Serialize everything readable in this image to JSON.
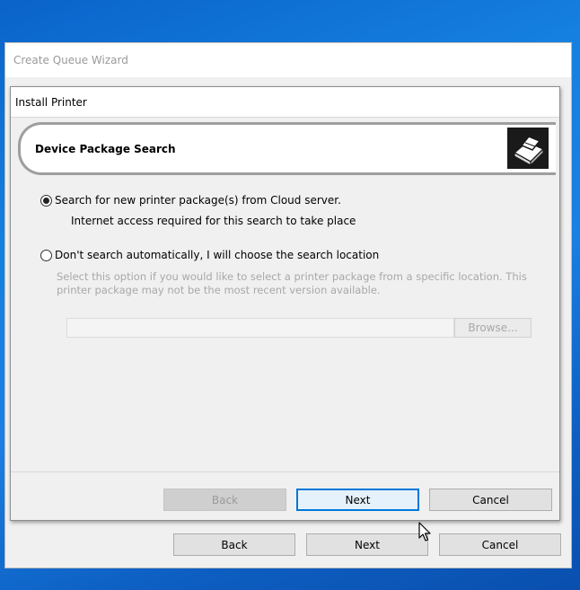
{
  "outer_window": {
    "title": "Create Queue Wizard",
    "back_label": "Back",
    "next_label": "Next",
    "cancel_label": "Cancel"
  },
  "inner_window": {
    "title": "Install Printer",
    "header_title": "Device Package Search",
    "header_icon": "printer-icon",
    "option_cloud": {
      "label": "Search for new printer package(s) from Cloud server.",
      "note": "Internet access required for this search to take place",
      "selected": true
    },
    "option_manual": {
      "label": "Don't search automatically, I will choose the search location",
      "note_line1": "Select this option if you would like to select a printer package from a specific location. This",
      "note_line2": "printer package may not be the most recent version available.",
      "selected": false
    },
    "path_input_value": "",
    "browse_label": "Browse...",
    "back_label": "Back",
    "next_label": "Next",
    "cancel_label": "Cancel"
  },
  "colors": {
    "desktop_blue": "#1580e0",
    "focus_blue": "#0078d7",
    "dialog_bg": "#f0f0f0"
  }
}
